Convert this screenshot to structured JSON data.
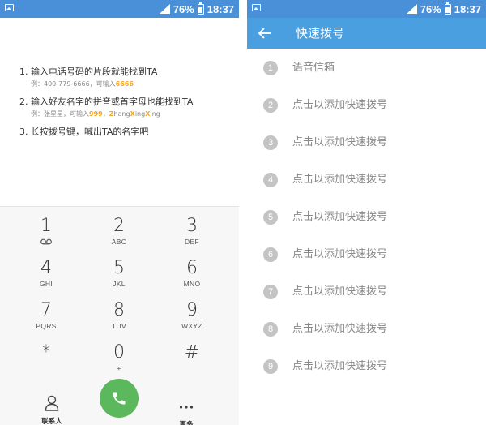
{
  "status_bar": {
    "battery": "76%",
    "time": "18:37"
  },
  "dialer": {
    "tips": [
      {
        "title": "1. 输入电话号码的片段就能找到TA",
        "example_prefix": "例：400-779-6666，可输入",
        "example_highlight": "6666"
      },
      {
        "title": "2. 输入好友名字的拼音或首字母也能找到TA",
        "example_prefix": "例：张星星，可输入",
        "example_highlight": "999",
        "example_sep": "，",
        "example_pinyin": [
          "Z",
          "hang",
          "X",
          "ing",
          "X",
          "ing"
        ]
      },
      {
        "title": "3. 长按拨号键，喊出TA的名字吧"
      }
    ],
    "keys": [
      {
        "digit": "1",
        "letters": ""
      },
      {
        "digit": "2",
        "letters": "ABC"
      },
      {
        "digit": "3",
        "letters": "DEF"
      },
      {
        "digit": "4",
        "letters": "GHI"
      },
      {
        "digit": "5",
        "letters": "JKL"
      },
      {
        "digit": "6",
        "letters": "MNO"
      },
      {
        "digit": "7",
        "letters": "PQRS"
      },
      {
        "digit": "8",
        "letters": "TUV"
      },
      {
        "digit": "9",
        "letters": "WXYZ"
      },
      {
        "digit": "*",
        "letters": ""
      },
      {
        "digit": "0",
        "letters": "+"
      },
      {
        "digit": "#",
        "letters": ""
      }
    ],
    "contacts_label": "联系人",
    "more_label": "更多",
    "icons": {
      "voicemail": "voicemail-icon",
      "contacts": "person-icon",
      "call": "phone-icon",
      "more": "more-dots-icon"
    }
  },
  "speed_dial": {
    "title": "快速拨号",
    "items": [
      {
        "num": "1",
        "label": "语音信箱"
      },
      {
        "num": "2",
        "label": "点击以添加快速拨号"
      },
      {
        "num": "3",
        "label": "点击以添加快速拨号"
      },
      {
        "num": "4",
        "label": "点击以添加快速拨号"
      },
      {
        "num": "5",
        "label": "点击以添加快速拨号"
      },
      {
        "num": "6",
        "label": "点击以添加快速拨号"
      },
      {
        "num": "7",
        "label": "点击以添加快速拨号"
      },
      {
        "num": "8",
        "label": "点击以添加快速拨号"
      },
      {
        "num": "9",
        "label": "点击以添加快速拨号"
      }
    ]
  },
  "colors": {
    "status_bar": "#4a90d9",
    "app_bar": "#4a9fe0",
    "call_green": "#5cb85c",
    "highlight_orange": "#f5a623"
  }
}
